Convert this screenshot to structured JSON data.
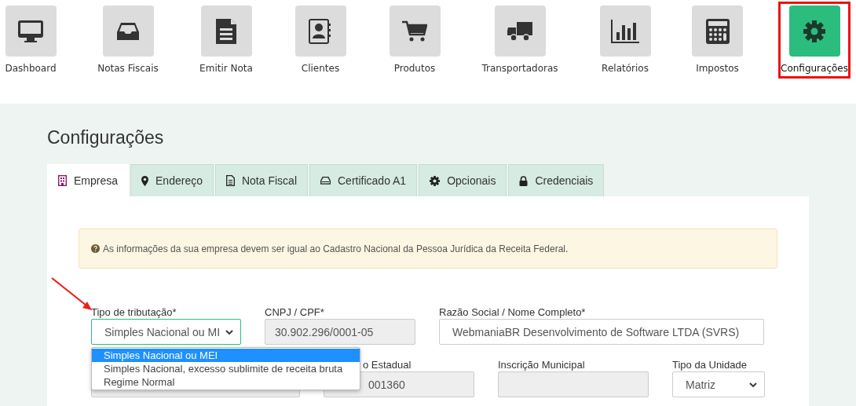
{
  "nav": [
    {
      "label": "Dashboard",
      "selected": false
    },
    {
      "label": "Notas Fiscais",
      "selected": false
    },
    {
      "label": "Emitir Nota",
      "selected": false
    },
    {
      "label": "Clientes",
      "selected": false
    },
    {
      "label": "Produtos",
      "selected": false
    },
    {
      "label": "Transportadoras",
      "selected": false
    },
    {
      "label": "Relatórios",
      "selected": false
    },
    {
      "label": "Impostos",
      "selected": false
    },
    {
      "label": "Configurações",
      "selected": true
    }
  ],
  "page_title": "Configurações",
  "tabs": [
    {
      "label": "Empresa",
      "selected": true
    },
    {
      "label": "Endereço",
      "selected": false
    },
    {
      "label": "Nota Fiscal",
      "selected": false
    },
    {
      "label": "Certificado A1",
      "selected": false
    },
    {
      "label": "Opcionais",
      "selected": false
    },
    {
      "label": "Credenciais",
      "selected": false
    }
  ],
  "alert": "As informações da sua empresa devem ser igual ao Cadastro Nacional da Pessoa Jurídica da Receita Federal.",
  "form": {
    "row1": [
      {
        "label": "Tipo de tributação*",
        "kind": "select",
        "value": "Simples Nacional ou MI",
        "focused": true
      },
      {
        "label": "CNPJ / CPF*",
        "kind": "readonly",
        "value": "30.902.296/0001-05",
        "focused": false
      },
      {
        "label": "Razão Social / Nome Completo*",
        "kind": "text",
        "value": "WebmaniaBR Desenvolvimento de Software LTDA (SVRS)",
        "focused": false
      }
    ],
    "row2": [
      {
        "kind": "readonly"
      },
      {
        "label": "o Estadual",
        "kind": "readonly",
        "value": "001360"
      },
      {
        "label": "Inscrição Municipal",
        "kind": "readonly"
      },
      {
        "label": "Tipo da Unidade",
        "kind": "select",
        "value": "Matriz"
      }
    ]
  },
  "dropdown": {
    "options": [
      {
        "label": "Simples Nacional ou MEI",
        "selected": true
      },
      {
        "label": "Simples Nacional, excesso sublimite de receita bruta",
        "selected": false
      },
      {
        "label": "Regime Normal",
        "selected": false
      }
    ]
  }
}
